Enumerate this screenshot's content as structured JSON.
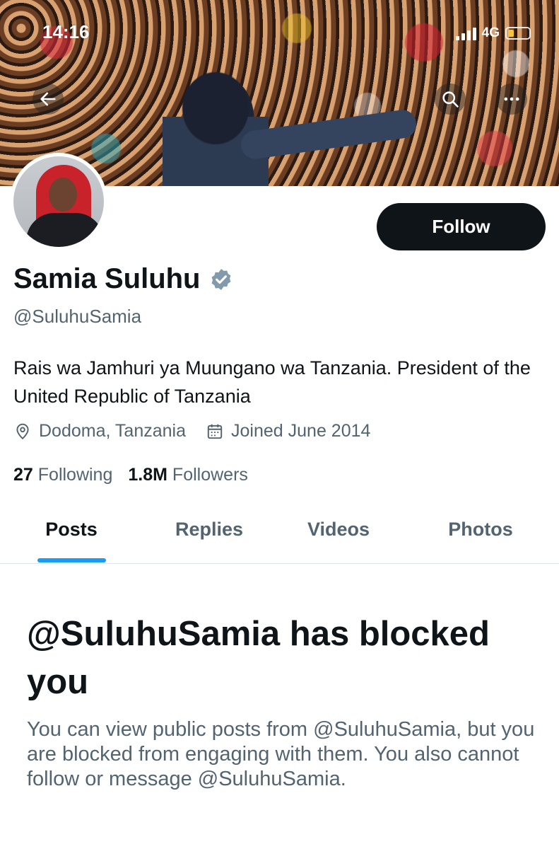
{
  "status_bar": {
    "time": "14:16",
    "network": "4G"
  },
  "profile": {
    "display_name": "Samia Suluhu",
    "handle": "@SuluhuSamia",
    "bio": "Rais wa Jamhuri ya Muungano wa Tanzania. President of the United Republic of Tanzania",
    "location": "Dodoma, Tanzania",
    "joined": "Joined June 2014",
    "follow_label": "Follow",
    "following_count": "27",
    "following_label": "Following",
    "followers_count": "1.8M",
    "followers_label": "Followers",
    "verified": true
  },
  "tabs": [
    {
      "label": "Posts",
      "active": true
    },
    {
      "label": "Replies",
      "active": false
    },
    {
      "label": "Videos",
      "active": false
    },
    {
      "label": "Photos",
      "active": false
    }
  ],
  "blocked": {
    "title": "@SuluhuSamia has blocked you",
    "message": "You can view public posts from @SuluhuSamia, but you are blocked from engaging with them. You also cannot follow or message @SuluhuSamia."
  },
  "icons": [
    "back-arrow-icon",
    "search-icon",
    "more-icon",
    "verified-badge-icon",
    "location-pin-icon",
    "calendar-icon",
    "signal-icon",
    "battery-icon"
  ],
  "colors": {
    "accent": "#1d9bf0",
    "text_primary": "#0f1419",
    "text_secondary": "#536471",
    "follow_bg": "#0f1419"
  }
}
